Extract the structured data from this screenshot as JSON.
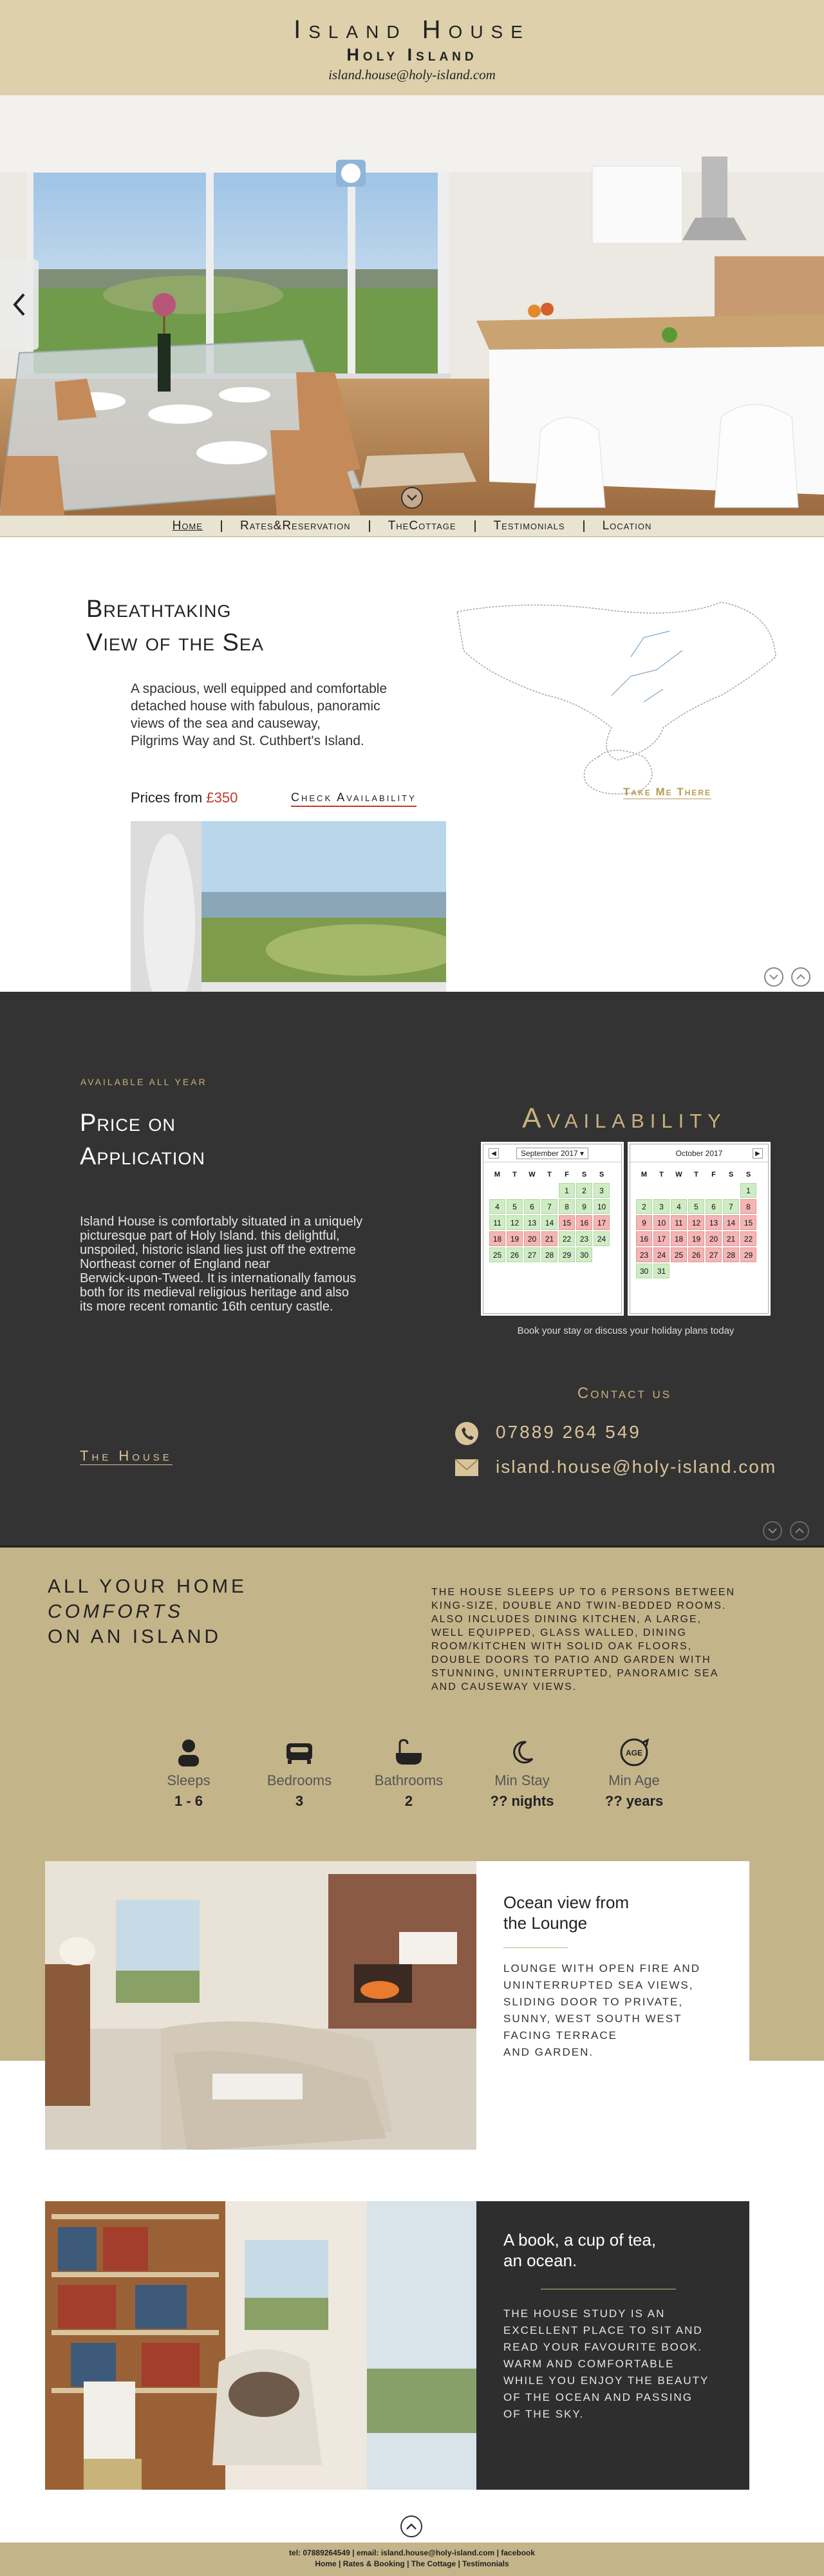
{
  "header": {
    "title": "Island House",
    "subtitle": "Holy Island",
    "email": "island.house@holy-island.com"
  },
  "nav": {
    "items": [
      "Home",
      "Rates&Reservation",
      "TheCottage",
      "Testimonials",
      "Location"
    ]
  },
  "intro": {
    "title_line1": "Breathtaking",
    "title_line2": "View of the Sea",
    "body_line1": "A spacious, well equipped and comfortable",
    "body_line2": "detached house with fabulous, panoramic",
    "body_line3": "views of the sea and causeway,",
    "body_line4": "Pilgrims Way and St. Cuthbert's Island.",
    "prices_label": "Prices from",
    "price": "£350",
    "check": "Check Availability",
    "map_link": "Take Me There"
  },
  "availability": {
    "eyebrow": "Available all year",
    "title_line1": "Price on",
    "title_line2": "Application",
    "para": [
      "Island House is comfortably situated in a uniquely",
      "picturesque part of Holy Island. this delightful,",
      "unspoiled, historic island lies just off the extreme",
      "Northeast corner of England near",
      "Berwick-upon-Tweed. It is internationally famous",
      "both for its medieval religious heritage and also",
      "its more recent romantic 16th century castle."
    ],
    "heading": "Availability",
    "cal1": {
      "month": "September 2017"
    },
    "cal2": {
      "month": "October 2017"
    },
    "day_names": [
      "M",
      "T",
      "W",
      "T",
      "F",
      "S",
      "S"
    ],
    "note": "Book your stay or discuss your holiday plans today",
    "contact_title": "Contact us",
    "phone": "07889 264 549",
    "email": "island.house@holy-island.com",
    "the_house": "The House"
  },
  "comforts": {
    "line1": "All your home",
    "line2": "comforts",
    "line3": "on an island",
    "desc": [
      "The House sleeps up to 6 persons between",
      "king-size, double and twin-bedded rooms.",
      "Also includes dining kitchen, a large,",
      "well equipped, glass walled, dining",
      "room/kitchen with solid oak floors,",
      "double doors to patio and garden with",
      "stunning, uninterrupted, panoramic sea",
      "and causeway views."
    ],
    "amenities": [
      {
        "label": "Sleeps",
        "value": "1 - 6",
        "icon": "person-icon"
      },
      {
        "label": "Bedrooms",
        "value": "3",
        "icon": "bed-icon"
      },
      {
        "label": "Bathrooms",
        "value": "2",
        "icon": "bath-icon"
      },
      {
        "label": "Min Stay",
        "value": "?? nights",
        "icon": "moon-icon"
      },
      {
        "label": "Min Age",
        "value": "?? years",
        "icon": "age-icon",
        "badge": "AGE"
      }
    ]
  },
  "lounge": {
    "title_line1": "Ocean view from",
    "title_line2": "the Lounge",
    "body": [
      "Lounge with open fire and",
      "uninterrupted sea views,",
      "sliding door to private,",
      "sunny, west south west",
      "facing terrace",
      "and garden."
    ]
  },
  "study": {
    "title_line1": "A book, a cup of tea,",
    "title_line2": "an ocean.",
    "body": [
      "The house study is an",
      "excellent place to sit and",
      "read your favourite book.",
      "Warm and comfortable",
      "while you enjoy the beauty",
      "of the ocean and passing",
      "of the sky."
    ]
  },
  "footer": {
    "line1": "tel: 07889264549 | email: island.house@holy-island.com | facebook",
    "line2": "Home | Rates & Booking | The Cottage | Testimonials"
  },
  "colors": {
    "beige": "#c4b48a",
    "dark": "#333333",
    "accent_red": "#c0392b"
  }
}
